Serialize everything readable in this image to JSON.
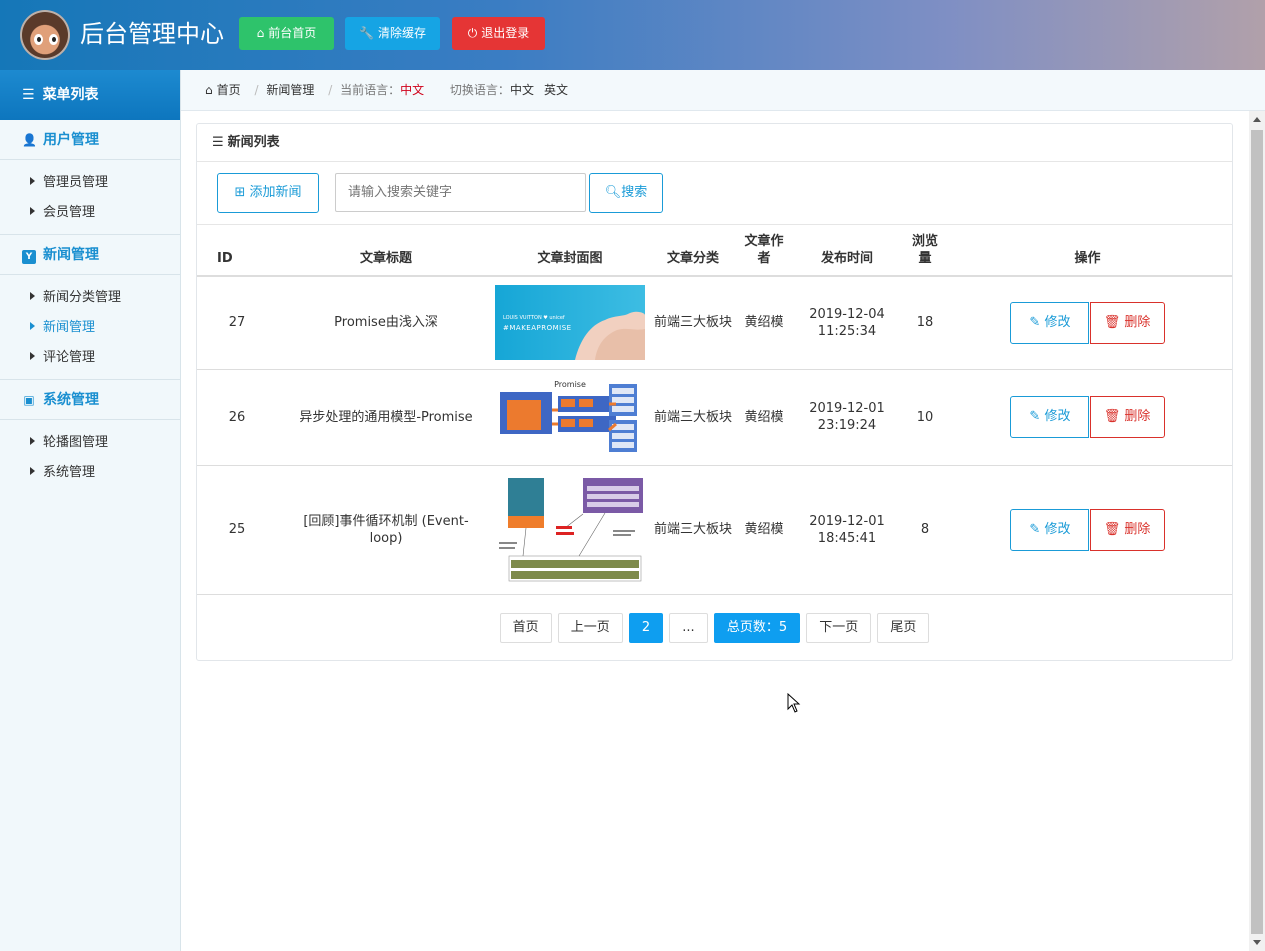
{
  "header": {
    "title": "后台管理中心",
    "buttons": [
      {
        "label": "前台首页",
        "icon": "home-icon",
        "color": "#2ec36b"
      },
      {
        "label": "清除缓存",
        "icon": "wrench-icon",
        "color": "#16a4e4"
      },
      {
        "label": "退出登录",
        "icon": "power-icon",
        "color": "#e53535"
      }
    ]
  },
  "sidebar": {
    "title": "菜单列表",
    "groups": [
      {
        "label": "用户管理",
        "icon": "user-icon",
        "items": [
          {
            "label": "管理员管理"
          },
          {
            "label": "会员管理"
          }
        ]
      },
      {
        "label": "新闻管理",
        "icon": "news-icon",
        "items": [
          {
            "label": "新闻分类管理"
          },
          {
            "label": "新闻管理"
          },
          {
            "label": "评论管理"
          }
        ]
      },
      {
        "label": "系统管理",
        "icon": "drive-icon",
        "items": [
          {
            "label": "轮播图管理"
          },
          {
            "label": "系统管理"
          }
        ]
      }
    ]
  },
  "breadcrumb": {
    "home": "首页",
    "current": "新闻管理",
    "lang_label": "当前语言：",
    "lang_value": "中文",
    "switch_label": "切换语言：",
    "switch_zh": "中文",
    "switch_en": "英文"
  },
  "panel": {
    "title": "新闻列表",
    "add_button": "添加新闻",
    "search_placeholder": "请输入搜索关键字",
    "search_button": "搜索"
  },
  "table": {
    "headers": {
      "id": "ID",
      "title": "文章标题",
      "cover": "文章封面图",
      "category": "文章分类",
      "author": "文章作者",
      "time": "发布时间",
      "views": "浏览量",
      "actions": "操作"
    },
    "rows": [
      {
        "id": "27",
        "title": "Promise由浅入深",
        "category": "前端三大板块",
        "author": "黄绍模",
        "date": "2019-12-04",
        "time": "11:25:34",
        "views": "18"
      },
      {
        "id": "26",
        "title": "异步处理的通用模型-Promise",
        "category": "前端三大板块",
        "author": "黄绍模",
        "date": "2019-12-01",
        "time": "23:19:24",
        "views": "10"
      },
      {
        "id": "25",
        "title": "[回顾]事件循环机制 (Event-loop)",
        "category": "前端三大板块",
        "author": "黄绍模",
        "date": "2019-12-01",
        "time": "18:45:41",
        "views": "8"
      }
    ],
    "edit_label": "修改",
    "delete_label": "删除"
  },
  "images": {
    "img1_line1": "LOUIS VUITTON ♥ unicef",
    "img1_line2": "#MAKEAPROMISE",
    "img2_title": "Promise"
  },
  "pager": {
    "first": "首页",
    "prev": "上一页",
    "current": "2",
    "ellipsis": "...",
    "total": "总页数：5",
    "next": "下一页",
    "last": "尾页"
  }
}
